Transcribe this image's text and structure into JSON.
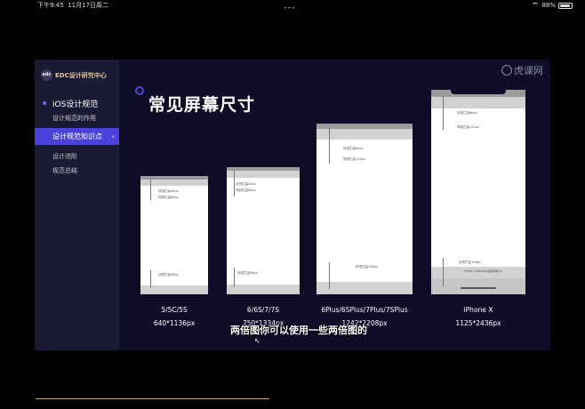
{
  "statusbar": {
    "time": "下午9:45",
    "date": "11月17日周二",
    "dots": "•••",
    "battery": "88%",
    "battery_level": 0.88
  },
  "sidebar": {
    "logo_mark": "edc",
    "logo_text": "EDC设计研究中心",
    "section_title": "iOS设计规范",
    "items": [
      {
        "label": "设计规范的作用"
      },
      {
        "label": "设计规范知识点",
        "active": true
      },
      {
        "label": "设计进阶"
      },
      {
        "label": "规范总结"
      }
    ],
    "chevron": "›"
  },
  "watermark": "虎课网",
  "slide": {
    "title": "常见屏幕尺寸",
    "phones": [
      {
        "name": "5/5C/5S",
        "size": "640*1136px",
        "annotations": {
          "status": "状态栏高40px",
          "nav": "导航栏高88px",
          "tab": "标签栏高98px"
        }
      },
      {
        "name": "6/6S/7/7S",
        "size": "750*1334px",
        "annotations": {
          "status": "状态栏高40px",
          "nav": "导航栏高88px",
          "tab": "标签栏高98px"
        }
      },
      {
        "name": "6Plus/6SPlus/7Plus/7SPlus",
        "size": "1242*2208px",
        "annotations": {
          "status": "状态栏高60px",
          "nav": "导航栏高132px",
          "tab": "标签栏高146px"
        }
      },
      {
        "name": "iPhone X",
        "size": "1125*2436px",
        "annotations": {
          "status": "状态栏高88px",
          "nav": "导航栏高132px",
          "tab": "标签栏高146px",
          "home": "Home Indicator高度68px"
        }
      }
    ]
  },
  "subtitle": "两倍图你可以使用一些两倍图的",
  "colors": {
    "accent": "#4b43d9",
    "background": "#0e0c26",
    "sidebar": "#1b1a34",
    "logo": "#e6c58a",
    "progress": "#c7a874"
  },
  "icons": {
    "wifi": "wifi-icon",
    "battery": "battery-icon",
    "logo": "edc-logo-icon",
    "watermark": "huke-logo-icon",
    "cursor": "mouse-cursor-icon"
  }
}
